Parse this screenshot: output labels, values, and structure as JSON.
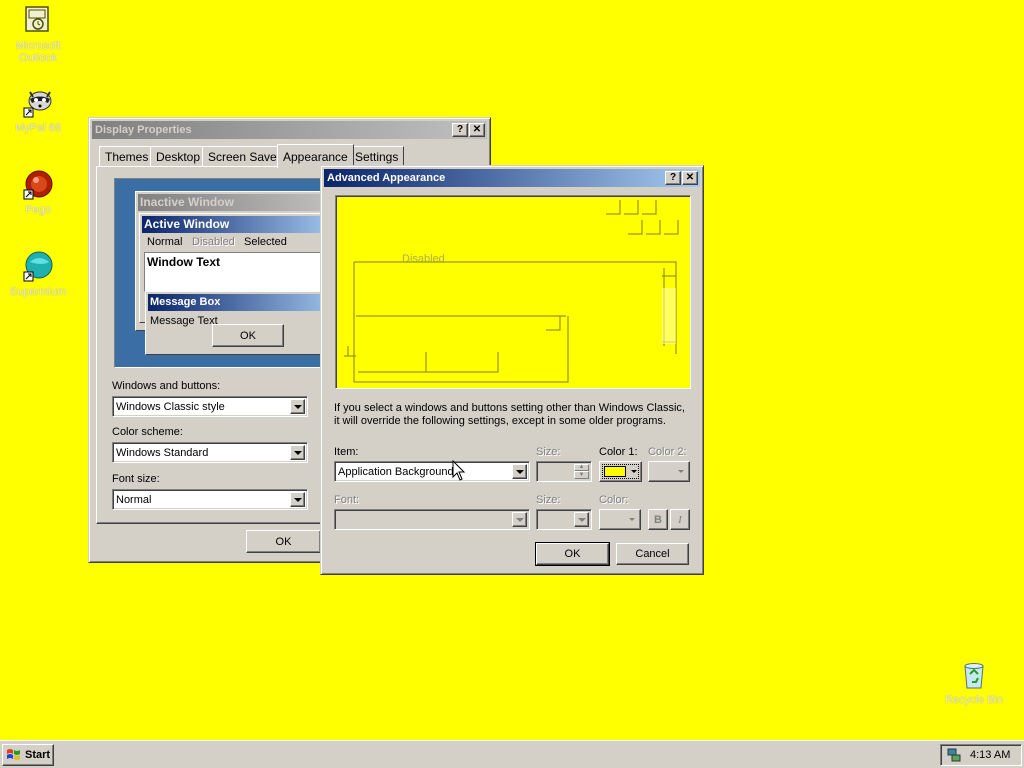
{
  "desktop": {
    "background": "#ffff00",
    "icons": [
      {
        "name": "outlook-icon",
        "label": "Microsoft Outlook"
      },
      {
        "name": "mypal-icon",
        "label": "MyPal 68"
      },
      {
        "name": "pego-icon",
        "label": "Pego"
      },
      {
        "name": "supermium-icon",
        "label": "Supermium"
      },
      {
        "name": "recycle-bin-icon",
        "label": "Recycle Bin"
      }
    ]
  },
  "display_properties": {
    "title": "Display Properties",
    "tabs": [
      {
        "label": "Themes"
      },
      {
        "label": "Desktop"
      },
      {
        "label": "Screen Saver"
      },
      {
        "label": "Appearance"
      },
      {
        "label": "Settings"
      }
    ],
    "preview": {
      "inactive_window": "Inactive Window",
      "active_window": "Active Window",
      "menu_normal": "Normal",
      "menu_disabled": "Disabled",
      "menu_selected": "Selected",
      "window_text": "Window Text",
      "message_box": "Message Box",
      "message_text": "Message Text",
      "ok": "OK"
    },
    "windows_buttons_label": "Windows and buttons:",
    "windows_buttons_value": "Windows Classic style",
    "color_scheme_label": "Color scheme:",
    "color_scheme_value": "Windows Standard",
    "font_size_label": "Font size:",
    "font_size_value": "Normal",
    "ok": "OK"
  },
  "advanced_appearance": {
    "title": "Advanced Appearance",
    "preview_disabled": "Disabled",
    "info_line1": "If you select a windows and buttons setting other than Windows Classic,",
    "info_line2": "it will override the following settings, except in some older programs.",
    "item_label": "Item:",
    "item_value": "Application Background",
    "size_label": "Size:",
    "color1_label": "Color 1:",
    "color1_value": "#ffff00",
    "color2_label": "Color 2:",
    "font_label": "Font:",
    "size2_label": "Size:",
    "color_label": "Color:",
    "bold": "B",
    "italic": "I",
    "ok": "OK",
    "cancel": "Cancel"
  },
  "taskbar": {
    "start": "Start",
    "time": "4:13 AM"
  }
}
